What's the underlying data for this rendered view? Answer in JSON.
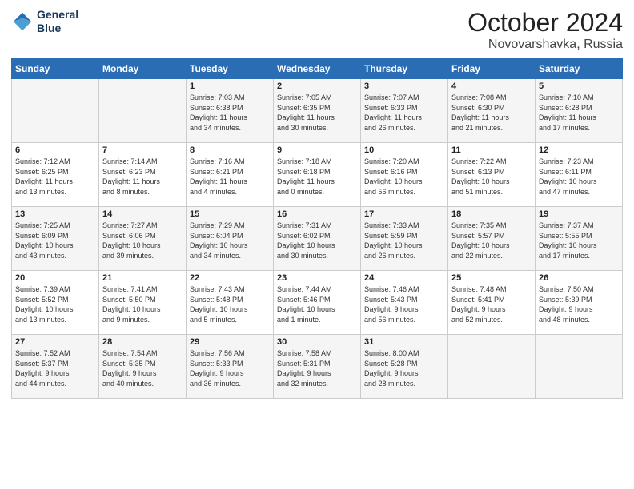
{
  "logo": {
    "line1": "General",
    "line2": "Blue"
  },
  "title": "October 2024",
  "location": "Novovarshavka, Russia",
  "days_of_week": [
    "Sunday",
    "Monday",
    "Tuesday",
    "Wednesday",
    "Thursday",
    "Friday",
    "Saturday"
  ],
  "weeks": [
    [
      {
        "day": "",
        "info": ""
      },
      {
        "day": "",
        "info": ""
      },
      {
        "day": "1",
        "info": "Sunrise: 7:03 AM\nSunset: 6:38 PM\nDaylight: 11 hours\nand 34 minutes."
      },
      {
        "day": "2",
        "info": "Sunrise: 7:05 AM\nSunset: 6:35 PM\nDaylight: 11 hours\nand 30 minutes."
      },
      {
        "day": "3",
        "info": "Sunrise: 7:07 AM\nSunset: 6:33 PM\nDaylight: 11 hours\nand 26 minutes."
      },
      {
        "day": "4",
        "info": "Sunrise: 7:08 AM\nSunset: 6:30 PM\nDaylight: 11 hours\nand 21 minutes."
      },
      {
        "day": "5",
        "info": "Sunrise: 7:10 AM\nSunset: 6:28 PM\nDaylight: 11 hours\nand 17 minutes."
      }
    ],
    [
      {
        "day": "6",
        "info": "Sunrise: 7:12 AM\nSunset: 6:25 PM\nDaylight: 11 hours\nand 13 minutes."
      },
      {
        "day": "7",
        "info": "Sunrise: 7:14 AM\nSunset: 6:23 PM\nDaylight: 11 hours\nand 8 minutes."
      },
      {
        "day": "8",
        "info": "Sunrise: 7:16 AM\nSunset: 6:21 PM\nDaylight: 11 hours\nand 4 minutes."
      },
      {
        "day": "9",
        "info": "Sunrise: 7:18 AM\nSunset: 6:18 PM\nDaylight: 11 hours\nand 0 minutes."
      },
      {
        "day": "10",
        "info": "Sunrise: 7:20 AM\nSunset: 6:16 PM\nDaylight: 10 hours\nand 56 minutes."
      },
      {
        "day": "11",
        "info": "Sunrise: 7:22 AM\nSunset: 6:13 PM\nDaylight: 10 hours\nand 51 minutes."
      },
      {
        "day": "12",
        "info": "Sunrise: 7:23 AM\nSunset: 6:11 PM\nDaylight: 10 hours\nand 47 minutes."
      }
    ],
    [
      {
        "day": "13",
        "info": "Sunrise: 7:25 AM\nSunset: 6:09 PM\nDaylight: 10 hours\nand 43 minutes."
      },
      {
        "day": "14",
        "info": "Sunrise: 7:27 AM\nSunset: 6:06 PM\nDaylight: 10 hours\nand 39 minutes."
      },
      {
        "day": "15",
        "info": "Sunrise: 7:29 AM\nSunset: 6:04 PM\nDaylight: 10 hours\nand 34 minutes."
      },
      {
        "day": "16",
        "info": "Sunrise: 7:31 AM\nSunset: 6:02 PM\nDaylight: 10 hours\nand 30 minutes."
      },
      {
        "day": "17",
        "info": "Sunrise: 7:33 AM\nSunset: 5:59 PM\nDaylight: 10 hours\nand 26 minutes."
      },
      {
        "day": "18",
        "info": "Sunrise: 7:35 AM\nSunset: 5:57 PM\nDaylight: 10 hours\nand 22 minutes."
      },
      {
        "day": "19",
        "info": "Sunrise: 7:37 AM\nSunset: 5:55 PM\nDaylight: 10 hours\nand 17 minutes."
      }
    ],
    [
      {
        "day": "20",
        "info": "Sunrise: 7:39 AM\nSunset: 5:52 PM\nDaylight: 10 hours\nand 13 minutes."
      },
      {
        "day": "21",
        "info": "Sunrise: 7:41 AM\nSunset: 5:50 PM\nDaylight: 10 hours\nand 9 minutes."
      },
      {
        "day": "22",
        "info": "Sunrise: 7:43 AM\nSunset: 5:48 PM\nDaylight: 10 hours\nand 5 minutes."
      },
      {
        "day": "23",
        "info": "Sunrise: 7:44 AM\nSunset: 5:46 PM\nDaylight: 10 hours\nand 1 minute."
      },
      {
        "day": "24",
        "info": "Sunrise: 7:46 AM\nSunset: 5:43 PM\nDaylight: 9 hours\nand 56 minutes."
      },
      {
        "day": "25",
        "info": "Sunrise: 7:48 AM\nSunset: 5:41 PM\nDaylight: 9 hours\nand 52 minutes."
      },
      {
        "day": "26",
        "info": "Sunrise: 7:50 AM\nSunset: 5:39 PM\nDaylight: 9 hours\nand 48 minutes."
      }
    ],
    [
      {
        "day": "27",
        "info": "Sunrise: 7:52 AM\nSunset: 5:37 PM\nDaylight: 9 hours\nand 44 minutes."
      },
      {
        "day": "28",
        "info": "Sunrise: 7:54 AM\nSunset: 5:35 PM\nDaylight: 9 hours\nand 40 minutes."
      },
      {
        "day": "29",
        "info": "Sunrise: 7:56 AM\nSunset: 5:33 PM\nDaylight: 9 hours\nand 36 minutes."
      },
      {
        "day": "30",
        "info": "Sunrise: 7:58 AM\nSunset: 5:31 PM\nDaylight: 9 hours\nand 32 minutes."
      },
      {
        "day": "31",
        "info": "Sunrise: 8:00 AM\nSunset: 5:28 PM\nDaylight: 9 hours\nand 28 minutes."
      },
      {
        "day": "",
        "info": ""
      },
      {
        "day": "",
        "info": ""
      }
    ]
  ]
}
